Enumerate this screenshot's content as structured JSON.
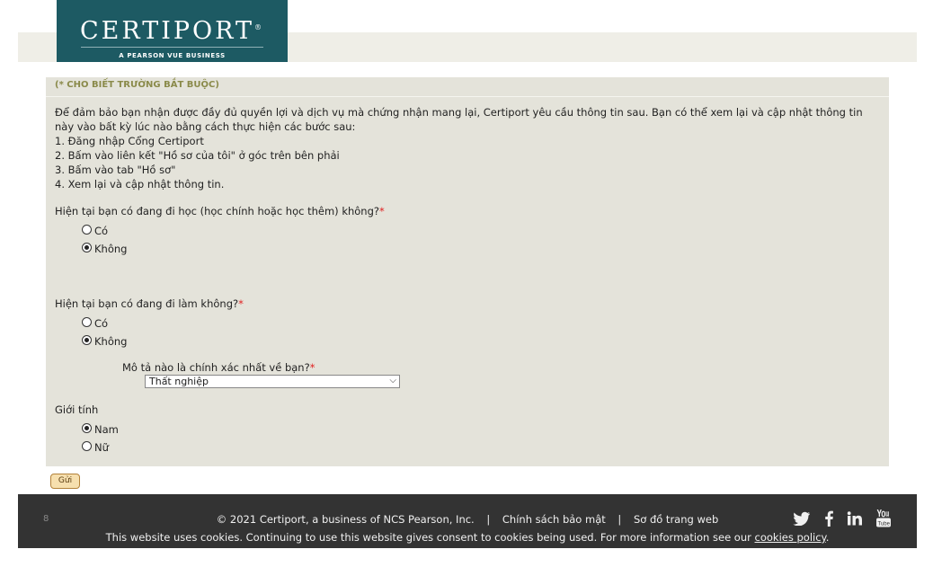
{
  "header": {
    "logo_main": "CERTIPORT",
    "logo_tagline": "A PEARSON VUE BUSINESS",
    "logo_reg": "®"
  },
  "form": {
    "required_note": "(* CHO BIẾT TRƯỜNG BẮT BUỘC)",
    "intro_line1": "Để đảm bảo bạn nhận được đầy đủ quyền lợi và dịch vụ mà chứng nhận mang lại, Certiport yêu cầu thông tin sau. Bạn có thể xem lại và cập nhật thông tin này vào bất kỳ lúc nào bằng cách thực hiện các bước sau:",
    "steps": [
      "1. Đăng nhập Cổng Certiport",
      "2. Bấm vào liên kết \"Hồ sơ của tôi\" ở góc trên bên phải",
      "3. Bấm vào tab \"Hồ sơ\"",
      "4. Xem lại và cập nhật thông tin."
    ],
    "q_study": {
      "label": "Hiện tại bạn có đang đi học (học chính hoặc học thêm) không?",
      "required": "*",
      "options": [
        "Có",
        "Không"
      ],
      "selected": "Không"
    },
    "q_work": {
      "label": "Hiện tại bạn có đang đi làm không?",
      "required": "*",
      "options": [
        "Có",
        "Không"
      ],
      "selected": "Không"
    },
    "q_describe": {
      "label": "Mô tả nào là chính xác nhất về bạn?",
      "required": "*",
      "selected": "Thất nghiệp"
    },
    "q_gender": {
      "label": "Giới tính",
      "options": [
        "Nam",
        "Nữ"
      ],
      "selected": "Nam"
    },
    "submit_label": "Gửi"
  },
  "footer": {
    "page_num": "8",
    "copyright": "© 2021 Certiport, a business of NCS Pearson, Inc.",
    "separator": "|",
    "privacy": "Chính sách bảo mật",
    "sitemap": "Sơ đồ trang web",
    "cookie_text": "This website uses cookies. Continuing to use this website gives consent to cookies being used. For more information see our",
    "cookie_link": "cookies policy",
    "cookie_end": "."
  }
}
